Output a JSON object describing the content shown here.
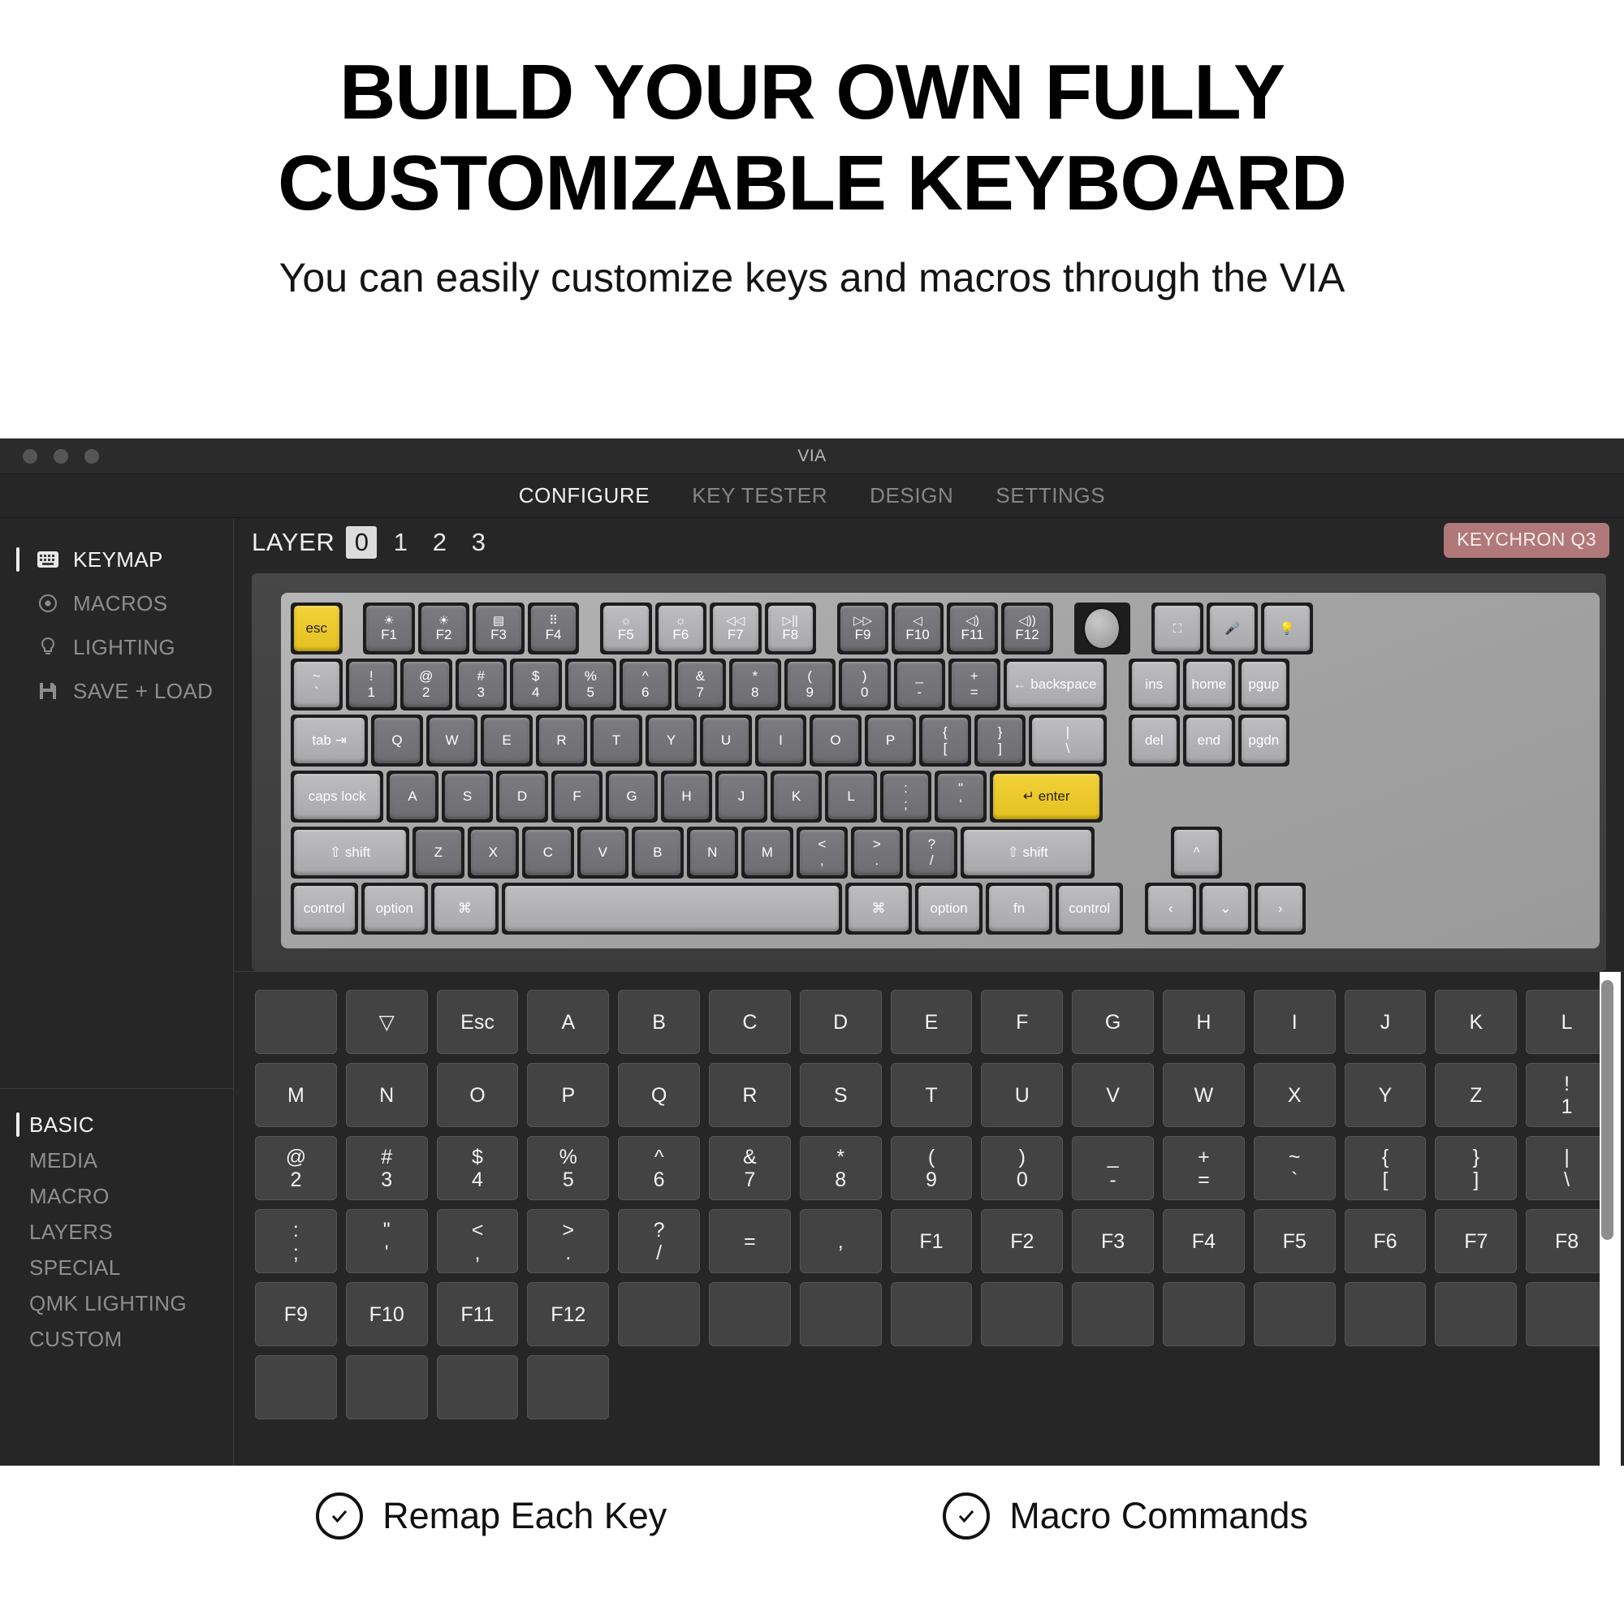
{
  "hero": {
    "title_line1": "BUILD YOUR OWN FULLY",
    "title_line2": "CUSTOMIZABLE KEYBOARD",
    "subtitle": "You can easily customize keys and macros through the VIA"
  },
  "window": {
    "title": "VIA",
    "tabs": [
      {
        "label": "CONFIGURE",
        "active": true
      },
      {
        "label": "KEY TESTER",
        "active": false
      },
      {
        "label": "DESIGN",
        "active": false
      },
      {
        "label": "SETTINGS",
        "active": false
      }
    ]
  },
  "sidebar": {
    "primary": [
      {
        "label": "KEYMAP",
        "icon": "keyboard-icon",
        "active": true
      },
      {
        "label": "MACROS",
        "icon": "record-icon",
        "active": false
      },
      {
        "label": "LIGHTING",
        "icon": "bulb-icon",
        "active": false
      },
      {
        "label": "SAVE + LOAD",
        "icon": "floppy-icon",
        "active": false
      }
    ],
    "categories": [
      {
        "label": "BASIC",
        "active": true
      },
      {
        "label": "MEDIA",
        "active": false
      },
      {
        "label": "MACRO",
        "active": false
      },
      {
        "label": "LAYERS",
        "active": false
      },
      {
        "label": "SPECIAL",
        "active": false
      },
      {
        "label": "QMK LIGHTING",
        "active": false
      },
      {
        "label": "CUSTOM",
        "active": false
      }
    ]
  },
  "layers": {
    "label": "LAYER",
    "options": [
      "0",
      "1",
      "2",
      "3"
    ],
    "selected": "0"
  },
  "device_badge": "KEYCHRON Q3",
  "colors": {
    "accent_yellow": "#f0cd2e",
    "badge_rose": "#b07878",
    "panel_dark": "#262626",
    "key_face": "#434343"
  },
  "keyboard": {
    "rows": [
      [
        {
          "w": 1.0,
          "style": "yellow",
          "lbl": "esc"
        },
        {
          "w": 0.28,
          "style": "gap"
        },
        {
          "w": 1.0,
          "style": "dark",
          "ico": "☀",
          "bot": "F1"
        },
        {
          "w": 1.0,
          "style": "dark",
          "ico": "☀",
          "bot": "F2"
        },
        {
          "w": 1.0,
          "style": "dark",
          "ico": "▤",
          "bot": "F3"
        },
        {
          "w": 1.0,
          "style": "dark",
          "ico": "⠿",
          "bot": "F4"
        },
        {
          "w": 0.28,
          "style": "gap"
        },
        {
          "w": 1.0,
          "style": "light",
          "ico": "☼",
          "bot": "F5"
        },
        {
          "w": 1.0,
          "style": "light",
          "ico": "☼",
          "bot": "F6"
        },
        {
          "w": 1.0,
          "style": "light",
          "ico": "◁◁",
          "bot": "F7"
        },
        {
          "w": 1.0,
          "style": "light",
          "ico": "▷||",
          "bot": "F8"
        },
        {
          "w": 0.28,
          "style": "gap"
        },
        {
          "w": 1.0,
          "style": "dark",
          "ico": "▷▷",
          "bot": "F9"
        },
        {
          "w": 1.0,
          "style": "dark",
          "ico": "◁",
          "bot": "F10"
        },
        {
          "w": 1.0,
          "style": "dark",
          "ico": "◁)",
          "bot": "F11"
        },
        {
          "w": 1.0,
          "style": "dark",
          "ico": "◁))",
          "bot": "F12"
        },
        {
          "w": 0.28,
          "style": "gap"
        },
        {
          "w": 1.1,
          "style": "knob"
        },
        {
          "w": 0.28,
          "style": "gap"
        },
        {
          "w": 1.0,
          "style": "light",
          "ico": "⛶"
        },
        {
          "w": 1.0,
          "style": "light",
          "ico": "🎤"
        },
        {
          "w": 1.0,
          "style": "light",
          "ico": "💡"
        }
      ],
      [
        {
          "w": 1.0,
          "style": "light",
          "top": "~",
          "bot": "`"
        },
        {
          "w": 1.0,
          "style": "dark",
          "top": "!",
          "bot": "1"
        },
        {
          "w": 1.0,
          "style": "dark",
          "top": "@",
          "bot": "2"
        },
        {
          "w": 1.0,
          "style": "dark",
          "top": "#",
          "bot": "3"
        },
        {
          "w": 1.0,
          "style": "dark",
          "top": "$",
          "bot": "4"
        },
        {
          "w": 1.0,
          "style": "dark",
          "top": "%",
          "bot": "5"
        },
        {
          "w": 1.0,
          "style": "dark",
          "top": "^",
          "bot": "6"
        },
        {
          "w": 1.0,
          "style": "dark",
          "top": "&",
          "bot": "7"
        },
        {
          "w": 1.0,
          "style": "dark",
          "top": "*",
          "bot": "8"
        },
        {
          "w": 1.0,
          "style": "dark",
          "top": "(",
          "bot": "9"
        },
        {
          "w": 1.0,
          "style": "dark",
          "top": ")",
          "bot": "0"
        },
        {
          "w": 1.0,
          "style": "dark",
          "top": "_",
          "bot": "-"
        },
        {
          "w": 1.0,
          "style": "dark",
          "top": "+",
          "bot": "="
        },
        {
          "w": 2.0,
          "style": "light",
          "lbl": "← backspace"
        },
        {
          "w": 0.3,
          "style": "gap"
        },
        {
          "w": 1.0,
          "style": "light",
          "lbl": "ins"
        },
        {
          "w": 1.0,
          "style": "light",
          "lbl": "home"
        },
        {
          "w": 1.0,
          "style": "light",
          "lbl": "pgup"
        }
      ],
      [
        {
          "w": 1.5,
          "style": "light",
          "lbl": "tab ⇥"
        },
        {
          "w": 1.0,
          "style": "dark",
          "lbl": "Q"
        },
        {
          "w": 1.0,
          "style": "dark",
          "lbl": "W"
        },
        {
          "w": 1.0,
          "style": "dark",
          "lbl": "E"
        },
        {
          "w": 1.0,
          "style": "dark",
          "lbl": "R"
        },
        {
          "w": 1.0,
          "style": "dark",
          "lbl": "T"
        },
        {
          "w": 1.0,
          "style": "dark",
          "lbl": "Y"
        },
        {
          "w": 1.0,
          "style": "dark",
          "lbl": "U"
        },
        {
          "w": 1.0,
          "style": "dark",
          "lbl": "I"
        },
        {
          "w": 1.0,
          "style": "dark",
          "lbl": "O"
        },
        {
          "w": 1.0,
          "style": "dark",
          "lbl": "P"
        },
        {
          "w": 1.0,
          "style": "dark",
          "top": "{",
          "bot": "["
        },
        {
          "w": 1.0,
          "style": "dark",
          "top": "}",
          "bot": "]"
        },
        {
          "w": 1.5,
          "style": "light",
          "top": "|",
          "bot": "\\"
        },
        {
          "w": 0.3,
          "style": "gap"
        },
        {
          "w": 1.0,
          "style": "light",
          "lbl": "del"
        },
        {
          "w": 1.0,
          "style": "light",
          "lbl": "end"
        },
        {
          "w": 1.0,
          "style": "light",
          "lbl": "pgdn"
        }
      ],
      [
        {
          "w": 1.8,
          "style": "light",
          "lbl": "caps lock"
        },
        {
          "w": 1.0,
          "style": "dark",
          "lbl": "A"
        },
        {
          "w": 1.0,
          "style": "dark",
          "lbl": "S"
        },
        {
          "w": 1.0,
          "style": "dark",
          "lbl": "D"
        },
        {
          "w": 1.0,
          "style": "dark",
          "lbl": "F"
        },
        {
          "w": 1.0,
          "style": "dark",
          "lbl": "G"
        },
        {
          "w": 1.0,
          "style": "dark",
          "lbl": "H"
        },
        {
          "w": 1.0,
          "style": "dark",
          "lbl": "J"
        },
        {
          "w": 1.0,
          "style": "dark",
          "lbl": "K"
        },
        {
          "w": 1.0,
          "style": "dark",
          "lbl": "L"
        },
        {
          "w": 1.0,
          "style": "dark",
          "top": ":",
          "bot": ";"
        },
        {
          "w": 1.0,
          "style": "dark",
          "top": "\"",
          "bot": "'"
        },
        {
          "w": 2.2,
          "style": "yellow",
          "lbl": "↵ enter"
        }
      ],
      [
        {
          "w": 2.3,
          "style": "light",
          "lbl": "⇧ shift"
        },
        {
          "w": 1.0,
          "style": "dark",
          "lbl": "Z"
        },
        {
          "w": 1.0,
          "style": "dark",
          "lbl": "X"
        },
        {
          "w": 1.0,
          "style": "dark",
          "lbl": "C"
        },
        {
          "w": 1.0,
          "style": "dark",
          "lbl": "V"
        },
        {
          "w": 1.0,
          "style": "dark",
          "lbl": "B"
        },
        {
          "w": 1.0,
          "style": "dark",
          "lbl": "N"
        },
        {
          "w": 1.0,
          "style": "dark",
          "lbl": "M"
        },
        {
          "w": 1.0,
          "style": "dark",
          "top": "<",
          "bot": ","
        },
        {
          "w": 1.0,
          "style": "dark",
          "top": ">",
          "bot": "."
        },
        {
          "w": 1.0,
          "style": "dark",
          "top": "?",
          "bot": "/"
        },
        {
          "w": 2.6,
          "style": "light",
          "lbl": "⇧ shift"
        },
        {
          "w": 1.35,
          "style": "gap"
        },
        {
          "w": 1.0,
          "style": "light",
          "lbl": "^"
        }
      ],
      [
        {
          "w": 1.3,
          "style": "light",
          "lbl": "control"
        },
        {
          "w": 1.3,
          "style": "light",
          "lbl": "option"
        },
        {
          "w": 1.3,
          "style": "light",
          "lbl": "⌘"
        },
        {
          "w": 6.6,
          "style": "light",
          "lbl": ""
        },
        {
          "w": 1.3,
          "style": "light",
          "lbl": "⌘"
        },
        {
          "w": 1.3,
          "style": "light",
          "lbl": "option"
        },
        {
          "w": 1.3,
          "style": "light",
          "lbl": "fn"
        },
        {
          "w": 1.3,
          "style": "light",
          "lbl": "control"
        },
        {
          "w": 0.3,
          "style": "gap"
        },
        {
          "w": 1.0,
          "style": "light",
          "lbl": "‹"
        },
        {
          "w": 1.0,
          "style": "light",
          "lbl": "⌄"
        },
        {
          "w": 1.0,
          "style": "light",
          "lbl": "›"
        }
      ]
    ]
  },
  "picker_keys": [
    {
      "t": ""
    },
    {
      "t": "▽"
    },
    {
      "t": "Esc"
    },
    {
      "t": "A"
    },
    {
      "t": "B"
    },
    {
      "t": "C"
    },
    {
      "t": "D"
    },
    {
      "t": "E"
    },
    {
      "t": "F"
    },
    {
      "t": "G"
    },
    {
      "t": "H"
    },
    {
      "t": "I"
    },
    {
      "t": "J"
    },
    {
      "t": "K"
    },
    {
      "t": "L"
    },
    {
      "t": "M"
    },
    {
      "t": "N"
    },
    {
      "t": "O"
    },
    {
      "t": "P"
    },
    {
      "t": "Q"
    },
    {
      "t": "R"
    },
    {
      "t": "S"
    },
    {
      "t": "T"
    },
    {
      "t": "U"
    },
    {
      "t": "V"
    },
    {
      "t": "W"
    },
    {
      "t": "X"
    },
    {
      "t": "Y"
    },
    {
      "t": "Z"
    },
    {
      "t": "!",
      "t2": "1"
    },
    {
      "t": "@",
      "t2": "2"
    },
    {
      "t": "#",
      "t2": "3"
    },
    {
      "t": "$",
      "t2": "4"
    },
    {
      "t": "%",
      "t2": "5"
    },
    {
      "t": "^",
      "t2": "6"
    },
    {
      "t": "&",
      "t2": "7"
    },
    {
      "t": "*",
      "t2": "8"
    },
    {
      "t": "(",
      "t2": "9"
    },
    {
      "t": ")",
      "t2": "0"
    },
    {
      "t": "_",
      "t2": "-"
    },
    {
      "t": "+",
      "t2": "="
    },
    {
      "t": "~",
      "t2": "`"
    },
    {
      "t": "{",
      "t2": "["
    },
    {
      "t": "}",
      "t2": "]"
    },
    {
      "t": "|",
      "t2": "\\"
    },
    {
      "t": ":",
      "t2": ";"
    },
    {
      "t": "\"",
      "t2": "'"
    },
    {
      "t": "<",
      "t2": ","
    },
    {
      "t": ">",
      "t2": "."
    },
    {
      "t": "?",
      "t2": "/"
    },
    {
      "t": "="
    },
    {
      "t": ","
    },
    {
      "t": "F1"
    },
    {
      "t": "F2"
    },
    {
      "t": "F3"
    },
    {
      "t": "F4"
    },
    {
      "t": "F5"
    },
    {
      "t": "F6"
    },
    {
      "t": "F7"
    },
    {
      "t": "F8"
    },
    {
      "t": "F9"
    },
    {
      "t": "F10"
    },
    {
      "t": "F11"
    },
    {
      "t": "F12"
    }
  ],
  "picker_note_row_visible": 4,
  "features": [
    {
      "label": "Remap Each Key",
      "icon": "check-circle-icon"
    },
    {
      "label": "Macro Commands",
      "icon": "check-circle-icon"
    }
  ]
}
